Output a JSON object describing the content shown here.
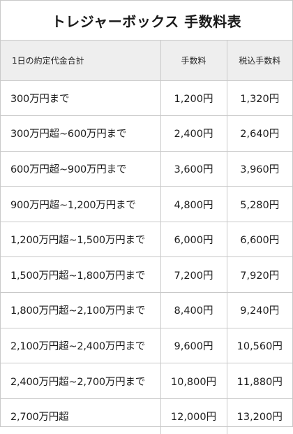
{
  "title": "トレジャーボックス 手数料表",
  "headers": {
    "total": "1日の約定代金合計",
    "fee": "手数料",
    "fee_tax": "税込手数料"
  },
  "rows": [
    {
      "range": "300万円まで",
      "fee": "1,200円",
      "fee_tax": "1,320円"
    },
    {
      "range": "300万円超~600万円まで",
      "fee": "2,400円",
      "fee_tax": "2,640円"
    },
    {
      "range": "600万円超~900万円まで",
      "fee": "3,600円",
      "fee_tax": "3,960円"
    },
    {
      "range": "900万円超~1,200万円まで",
      "fee": "4,800円",
      "fee_tax": "5,280円"
    },
    {
      "range": "1,200万円超~1,500万円まで",
      "fee": "6,000円",
      "fee_tax": "6,600円"
    },
    {
      "range": "1,500万円超~1,800万円まで",
      "fee": "7,200円",
      "fee_tax": "7,920円"
    },
    {
      "range": "1,800万円超~2,100万円まで",
      "fee": "8,400円",
      "fee_tax": "9,240円"
    },
    {
      "range": "2,100万円超~2,400万円まで",
      "fee": "9,600円",
      "fee_tax": "10,560円"
    },
    {
      "range": "2,400万円超~2,700万円まで",
      "fee": "10,800円",
      "fee_tax": "11,880円"
    },
    {
      "range": "2,700万円超",
      "fee": "12,000円",
      "fee_tax": "13,200円"
    }
  ]
}
